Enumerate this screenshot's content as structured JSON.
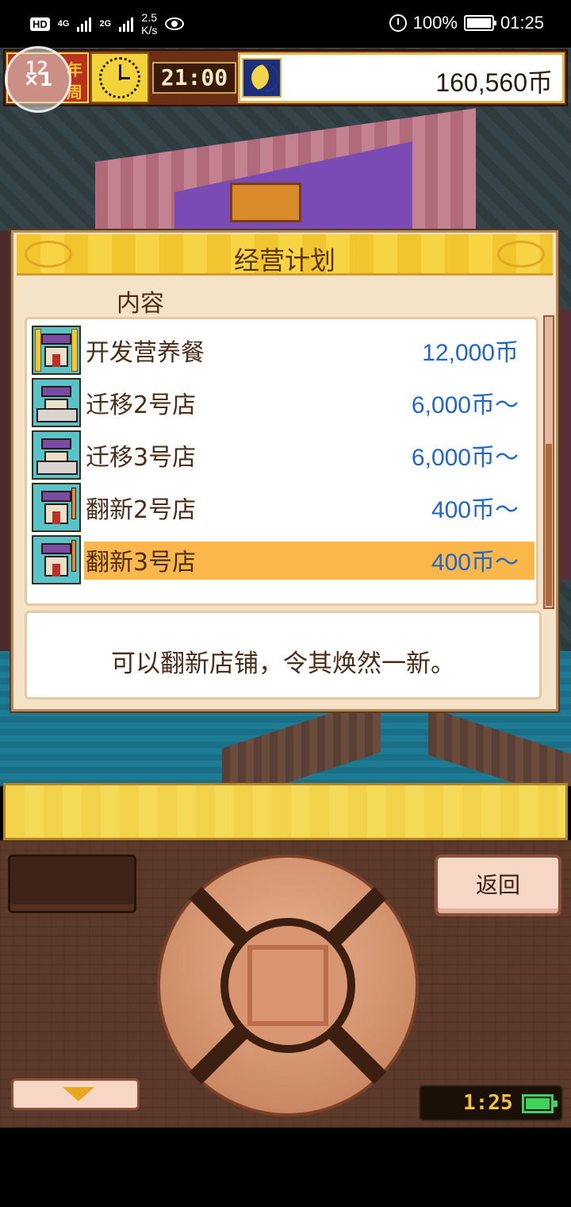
{
  "statusbar": {
    "hd": "HD",
    "net1": "4G",
    "net2": "2G",
    "speed_value": "2.5",
    "speed_unit": "K/s",
    "battery": "100%",
    "time": "01:25"
  },
  "hud": {
    "year": "12",
    "year_unit": "年",
    "week_unit": "周",
    "game_time": "21:00",
    "money": "160,560币",
    "speed_button": "×1"
  },
  "dialog": {
    "title": "经营计划",
    "column_label": "内容",
    "items": [
      {
        "label": "开发营养餐",
        "price": "12,000币",
        "icon": "upgrade-building-icon",
        "selected": false
      },
      {
        "label": "迁移2号店",
        "price": "6,000币～",
        "icon": "relocate-truck-icon",
        "selected": false
      },
      {
        "label": "迁移3号店",
        "price": "6,000币～",
        "icon": "relocate-truck-icon",
        "selected": false
      },
      {
        "label": "翻新2号店",
        "price": "400币～",
        "icon": "renovate-crane-icon",
        "selected": false
      },
      {
        "label": "翻新3号店",
        "price": "400币～",
        "icon": "renovate-crane-icon",
        "selected": true
      }
    ],
    "description": "可以翻新店铺，令其焕然一新。"
  },
  "controls": {
    "back_label": "返回",
    "clock_time": "1:25"
  },
  "colors": {
    "price": "#1f67c8",
    "selected_row": "#fbb74a",
    "header": "#f0c52e"
  }
}
